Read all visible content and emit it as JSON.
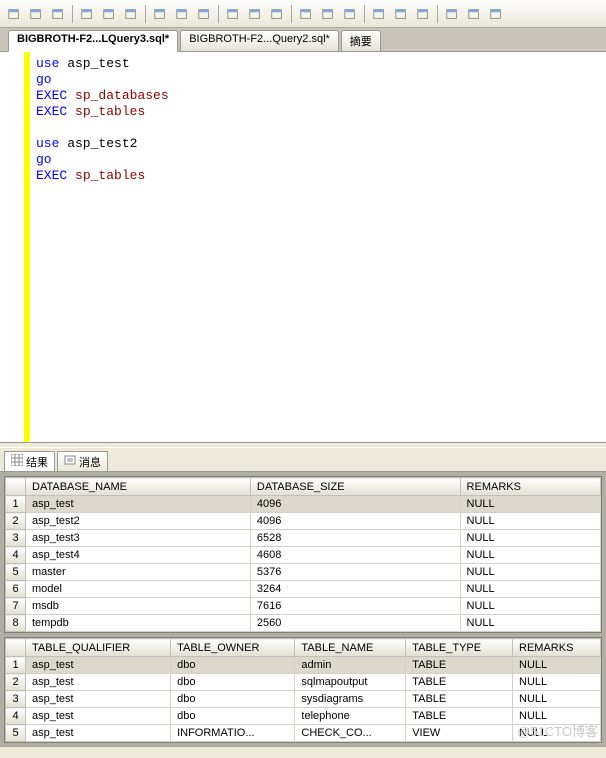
{
  "toolbar_icons": [
    "new-file",
    "open",
    "save",
    "cut",
    "copy",
    "paste",
    "floppy",
    "table",
    "undo",
    "redo",
    "grid2",
    "bookmark",
    "back",
    "forward",
    "indent",
    "outdent",
    "zoom",
    "list",
    "list2",
    "comment",
    "uncomment"
  ],
  "tabs": [
    {
      "label": "BIGBROTH-F2...LQuery3.sql*",
      "active": true
    },
    {
      "label": "BIGBROTH-F2...Query2.sql*",
      "active": false
    },
    {
      "label": "摘要",
      "active": false
    }
  ],
  "code_lines": [
    [
      {
        "t": "use",
        "c": "kw-blue"
      },
      {
        "t": " asp_test",
        "c": "kw-black"
      }
    ],
    [
      {
        "t": "go",
        "c": "kw-blue"
      }
    ],
    [
      {
        "t": "EXEC",
        "c": "kw-blue"
      },
      {
        "t": " ",
        "c": "kw-black"
      },
      {
        "t": "sp_databases",
        "c": "kw-red"
      }
    ],
    [
      {
        "t": "EXEC",
        "c": "kw-blue"
      },
      {
        "t": " ",
        "c": "kw-black"
      },
      {
        "t": "sp_tables",
        "c": "kw-red"
      }
    ],
    [
      {
        "t": "",
        "c": "kw-black"
      }
    ],
    [
      {
        "t": "use",
        "c": "kw-blue"
      },
      {
        "t": " asp_test2",
        "c": "kw-black"
      }
    ],
    [
      {
        "t": "go",
        "c": "kw-blue"
      }
    ],
    [
      {
        "t": "EXEC",
        "c": "kw-blue"
      },
      {
        "t": " ",
        "c": "kw-black"
      },
      {
        "t": "sp_tables",
        "c": "kw-red"
      }
    ]
  ],
  "result_tabs": [
    {
      "label": "结果",
      "icon": "grid"
    },
    {
      "label": "消息",
      "icon": "msg"
    }
  ],
  "grid1": {
    "headers": [
      "DATABASE_NAME",
      "DATABASE_SIZE",
      "REMARKS"
    ],
    "rows": [
      [
        "asp_test",
        "4096",
        "NULL"
      ],
      [
        "asp_test2",
        "4096",
        "NULL"
      ],
      [
        "asp_test3",
        "6528",
        "NULL"
      ],
      [
        "asp_test4",
        "4608",
        "NULL"
      ],
      [
        "master",
        "5376",
        "NULL"
      ],
      [
        "model",
        "3264",
        "NULL"
      ],
      [
        "msdb",
        "7616",
        "NULL"
      ],
      [
        "tempdb",
        "2560",
        "NULL"
      ]
    ]
  },
  "grid2": {
    "headers": [
      "TABLE_QUALIFIER",
      "TABLE_OWNER",
      "TABLE_NAME",
      "TABLE_TYPE",
      "REMARKS"
    ],
    "rows": [
      [
        "asp_test",
        "dbo",
        "admin",
        "TABLE",
        "NULL"
      ],
      [
        "asp_test",
        "dbo",
        "sqlmapoutput",
        "TABLE",
        "NULL"
      ],
      [
        "asp_test",
        "dbo",
        "sysdiagrams",
        "TABLE",
        "NULL"
      ],
      [
        "asp_test",
        "dbo",
        "telephone",
        "TABLE",
        "NULL"
      ],
      [
        "asp_test",
        "INFORMATIO...",
        "CHECK_CO...",
        "VIEW",
        "NULL"
      ]
    ]
  },
  "watermark": "@51CTO博客"
}
